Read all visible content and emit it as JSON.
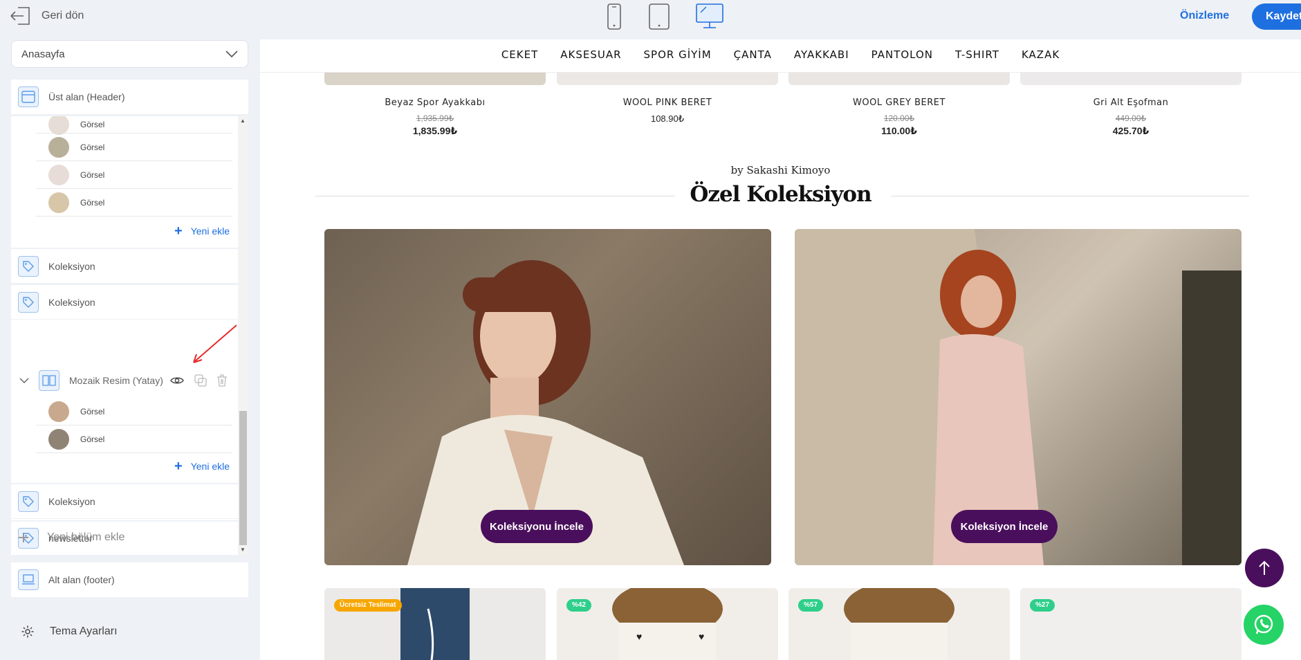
{
  "topbar": {
    "back_label": "Geri dön",
    "preview_label": "Önizleme",
    "save_label": "Kaydet",
    "devices": [
      "mobile",
      "tablet",
      "desktop"
    ],
    "active_device": "desktop",
    "accent": "#1e6fe0"
  },
  "sidebar": {
    "page_select": "Anasayfa",
    "header_label": "Üst alan (Header)",
    "gorsel_items_top": [
      "Görsel",
      "Görsel",
      "Görsel",
      "Görsel"
    ],
    "add_new": "Yeni ekle",
    "koleksiyon1": "Koleksiyon",
    "koleksiyon2": "Koleksiyon",
    "mozaik_label": "Mozaik Resim (Yatay)",
    "gorsel_items_mozaik": [
      "Görsel",
      "Görsel"
    ],
    "add_new2": "Yeni ekle",
    "koleksiyon3": "Koleksiyon",
    "newsletter": "newsletter",
    "new_section": "Yeni bölüm ekle",
    "footer_label": "Alt alan (footer)",
    "theme_settings": "Tema Ayarları"
  },
  "site": {
    "nav": [
      "CEKET",
      "AKSESUAR",
      "SPOR GİYİM",
      "ÇANTA",
      "AYAKKABI",
      "PANTOLON",
      "T-SHIRT",
      "KAZAK"
    ],
    "products_top": [
      {
        "name": "Beyaz Spor Ayakkabı",
        "old_price": "1,935.99₺",
        "price": "1,835.99₺"
      },
      {
        "name": "WOOL PINK BERET",
        "old_price": "",
        "price": "108.90₺"
      },
      {
        "name": "WOOL GREY BERET",
        "old_price": "120.00₺",
        "price": "110.00₺"
      },
      {
        "name": "Gri Alt Eşofman",
        "old_price": "449.00₺",
        "price": "425.70₺"
      }
    ],
    "byline": "by Sakashi Kimoyo",
    "section_title": "Özel Koleksiyon",
    "banners": [
      {
        "button": "Koleksiyonu İncele"
      },
      {
        "button": "Koleksiyon İncele"
      }
    ],
    "badges": [
      {
        "text": "Ücretsiz Teslimat",
        "color": "#f7a600"
      },
      {
        "text": "%42",
        "color": "#2ecf8a"
      },
      {
        "text": "%57",
        "color": "#2ecf8a"
      },
      {
        "text": "%27",
        "color": "#2ecf8a"
      }
    ],
    "brand_color": "#4a0f5c"
  }
}
